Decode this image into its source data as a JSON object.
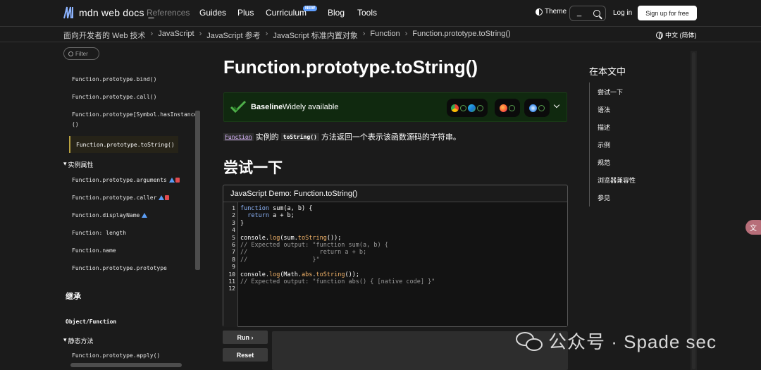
{
  "nav": {
    "logo": "mdn web docs",
    "links": [
      "References",
      "Guides",
      "Plus",
      "Curriculum",
      "Blog",
      "Tools"
    ],
    "new_badge": "NEW",
    "theme": "Theme",
    "search_value": "_",
    "login": "Log in",
    "signup": "Sign up for free"
  },
  "breadcrumb": [
    "面向开发者的 Web 技术",
    "JavaScript",
    "JavaScript 参考",
    "JavaScript 标准内置对象",
    "Function",
    "Function.prototype.toString()"
  ],
  "language": "中文 (简体)",
  "sidebar": {
    "filter": "Filter",
    "items_top": [
      "Function.prototype.bind()",
      "Function.prototype.call()",
      "Function.prototype[Symbol.hasInstance",
      "()"
    ],
    "active": "Function.prototype.toString()",
    "instance_props_heading": "实例属性",
    "instance_props": [
      "Function.prototype.arguments",
      "Function.prototype.caller",
      "Function.displayName",
      "Function: length",
      "Function.name",
      "Function.prototype.prototype"
    ],
    "inheritance_heading": "继承",
    "inherit_group": "Object/Function",
    "static_methods_heading": "静态方法",
    "static_methods": [
      "Function.prototype.apply()"
    ]
  },
  "main": {
    "title": "Function.prototype.toString()",
    "baseline_label": "Baseline",
    "baseline_status": "Widely available",
    "desc_link": "Function",
    "desc_mid": " 实例的 ",
    "desc_code": "toString()",
    "desc_end": " 方法返回一个表示该函数源码的字符串。",
    "try_heading": "尝试一下",
    "demo_title": "JavaScript Demo: Function.toString()",
    "run_button": "Run ›",
    "reset_button": "Reset"
  },
  "code_lines": [
    "function sum(a, b) {",
    "  return a + b;",
    "}",
    "",
    "console.log(sum.toString());",
    "// Expected output: \"function sum(a, b) {",
    "//                    return a + b;",
    "//                  }\"",
    "",
    "console.log(Math.abs.toString());",
    "// Expected output: \"function abs() { [native code] }\"",
    ""
  ],
  "line_numbers": [
    "1",
    "2",
    "3",
    "4",
    "5",
    "6",
    "7",
    "8",
    "9",
    "10",
    "11",
    "12"
  ],
  "toc": {
    "title": "在本文中",
    "items": [
      "尝试一下",
      "语法",
      "描述",
      "示例",
      "规范",
      "浏览器兼容性",
      "参见"
    ]
  },
  "watermark": "公众号 · Spade sec",
  "colors": {
    "background": "#1b1b1b",
    "baseline_bg": "#10290f",
    "link_purple": "#dcb8ff",
    "active_border": "#b8a140",
    "keyword_blue": "#8fb8ff"
  }
}
